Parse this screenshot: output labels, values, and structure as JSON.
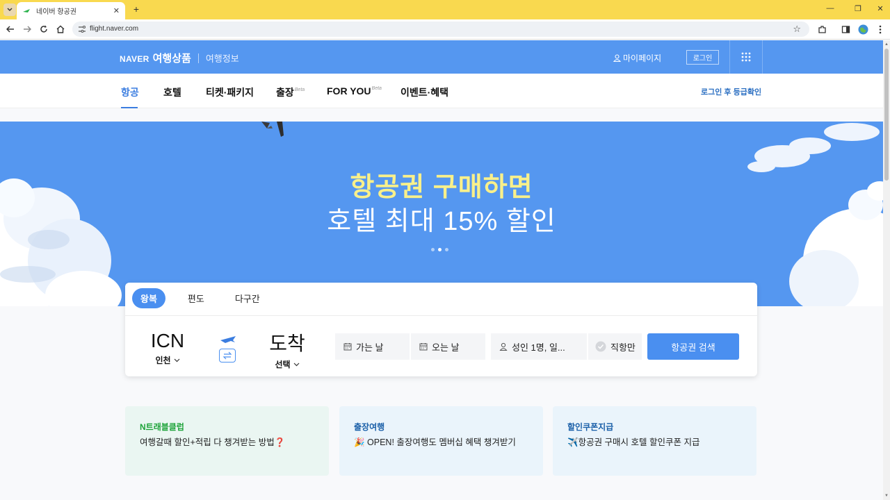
{
  "browser": {
    "tab_title": "네이버 항공권",
    "url": "flight.naver.com",
    "accent": "#f9d94f"
  },
  "header": {
    "logo": "NAVER",
    "product": "여행상품",
    "info": "여행정보",
    "mypage": "마이페이지",
    "login": "로그인",
    "color": "#5597f0"
  },
  "subnav": {
    "items": [
      {
        "label": "항공",
        "active": true
      },
      {
        "label": "호텔"
      },
      {
        "label": "티켓·패키지"
      },
      {
        "label": "출장",
        "badge": "Beta"
      },
      {
        "label": "FOR YOU",
        "badge": "Beta"
      },
      {
        "label": "이벤트·혜택"
      }
    ],
    "grade": "로그인 후 등급확인"
  },
  "banner": {
    "line1": "항공권 구매하면",
    "line2": "호텔 최대 15% 할인",
    "slides": 3,
    "active_slide": 2
  },
  "search": {
    "trip_tabs": [
      "왕복",
      "편도",
      "다구간"
    ],
    "active_trip": "왕복",
    "origin": {
      "code": "ICN",
      "city": "인천"
    },
    "destination": {
      "code": "도착",
      "city": "선택"
    },
    "depart": "가는 날",
    "return": "오는 날",
    "passengers": "성인 1명, 일...",
    "direct": "직항만",
    "button": "항공권 검색"
  },
  "promos": [
    {
      "title": "N트래블클럽",
      "body": "여행갈때 할인+적립 다 챙겨받는 방법❓",
      "title_color": "#1fa43b",
      "bg": "#eaf6f2"
    },
    {
      "title": "출장여행",
      "body": "🎉 OPEN! 출장여행도 멤버십 혜택 챙겨받기",
      "title_color": "#1a5fa8",
      "bg": "#eaf4fb"
    },
    {
      "title": "할인쿠폰지급",
      "body": "✈️항공권 구매시 호텔 할인쿠폰 지급",
      "title_color": "#1a5fa8",
      "bg": "#eaf4fb"
    }
  ]
}
